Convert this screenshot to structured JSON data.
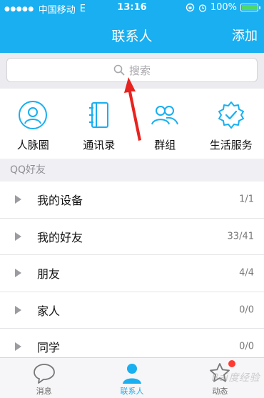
{
  "status_bar": {
    "signal": "●●●●●",
    "carrier": "中国移动",
    "network": "E",
    "time": "13:16",
    "battery_text": "100%",
    "battery_level": 1.0
  },
  "nav": {
    "title": "联系人",
    "add_label": "添加"
  },
  "search": {
    "placeholder": "搜索"
  },
  "quick_actions": [
    {
      "label": "人脉圈",
      "icon": "contacts-circle-icon"
    },
    {
      "label": "通讯录",
      "icon": "address-book-icon"
    },
    {
      "label": "群组",
      "icon": "group-icon"
    },
    {
      "label": "生活服务",
      "icon": "life-service-icon"
    }
  ],
  "section_header": "QQ好友",
  "groups": [
    {
      "name": "我的设备",
      "count": "1/1"
    },
    {
      "name": "我的好友",
      "count": "33/41"
    },
    {
      "name": "朋友",
      "count": "4/4"
    },
    {
      "name": "家人",
      "count": "0/0"
    },
    {
      "name": "同学",
      "count": "0/0"
    }
  ],
  "tabs": [
    {
      "label": "消息",
      "icon": "message-bubble-icon"
    },
    {
      "label": "联系人",
      "icon": "contacts-person-icon",
      "active": true
    },
    {
      "label": "动态",
      "icon": "star-icon"
    }
  ],
  "watermark": "Bai度经验",
  "colors": {
    "accent": "#19aff0",
    "annotation_arrow": "#e8231f",
    "badge": "#ff3b30"
  }
}
